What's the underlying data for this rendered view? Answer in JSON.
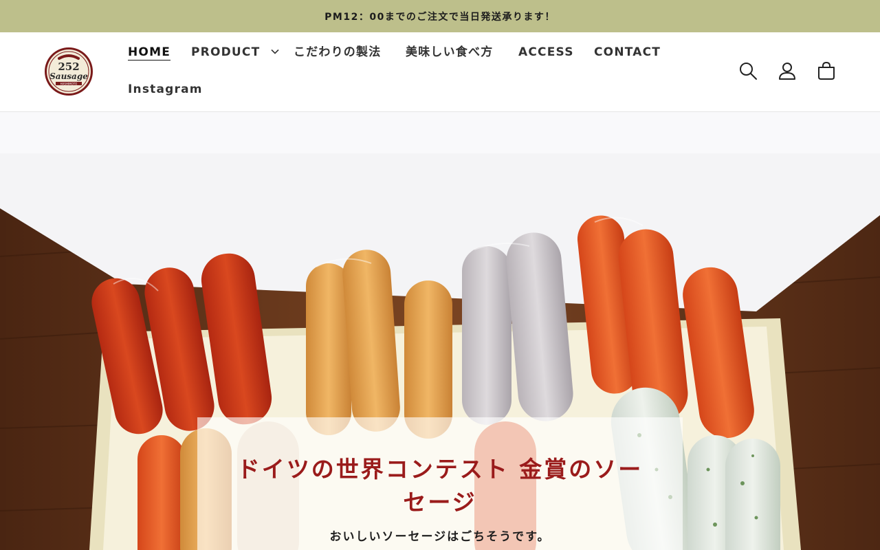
{
  "announcement": {
    "text": "PM12：00までのご注文で当日発送承ります！"
  },
  "logo": {
    "line1": "252",
    "line2": "Sausage",
    "line3": "HASHIMOTO"
  },
  "nav": {
    "items": [
      {
        "label": "HOME",
        "active": true
      },
      {
        "label": "PRODUCT",
        "has_dropdown": true
      },
      {
        "label": "こだわりの製法"
      },
      {
        "label": "美味しい食べ方"
      },
      {
        "label": "ACCESS"
      },
      {
        "label": "CONTACT"
      },
      {
        "label": "Instagram"
      }
    ]
  },
  "header_icons": [
    "search-icon",
    "account-icon",
    "cart-icon"
  ],
  "hero": {
    "title": "ドイツの世界コンテスト 金賞のソーセージ",
    "subtitle": "おいしいソーセージはごちそうです。"
  },
  "colors": {
    "announcement_bg": "#bdbf8b",
    "title_red": "#9a1b1b",
    "wood": "#6a3a1f"
  }
}
